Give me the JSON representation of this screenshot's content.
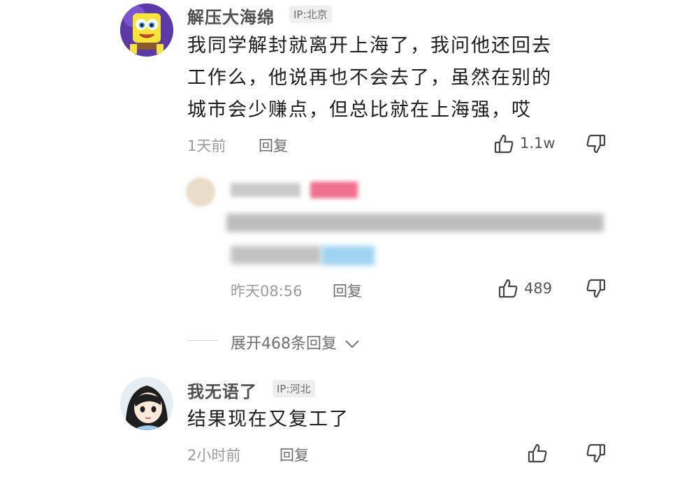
{
  "comments": [
    {
      "username": "解压大海绵",
      "ip": "IP:北京",
      "lines": [
        "我同学解封就离开上海了，我问他还回去",
        "工作么，他说再也不会去了，虽然在别的",
        "城市会少赚点，但总比就在上海强，哎"
      ],
      "time": "1天前",
      "reply_label": "回复",
      "likes": "1.1w"
    },
    {
      "username": "我无语了",
      "ip": "IP:河北",
      "lines": [
        "结果现在又复工了"
      ],
      "time": "2小时前",
      "reply_label": "回复"
    }
  ],
  "nested_reply": {
    "time": "昨天08:56",
    "reply_label": "回复",
    "likes": "489"
  },
  "expand": {
    "label": "展开468条回复"
  },
  "colors": {
    "accent_pink": "#f07090",
    "accent_blue": "#9fd3f2"
  }
}
